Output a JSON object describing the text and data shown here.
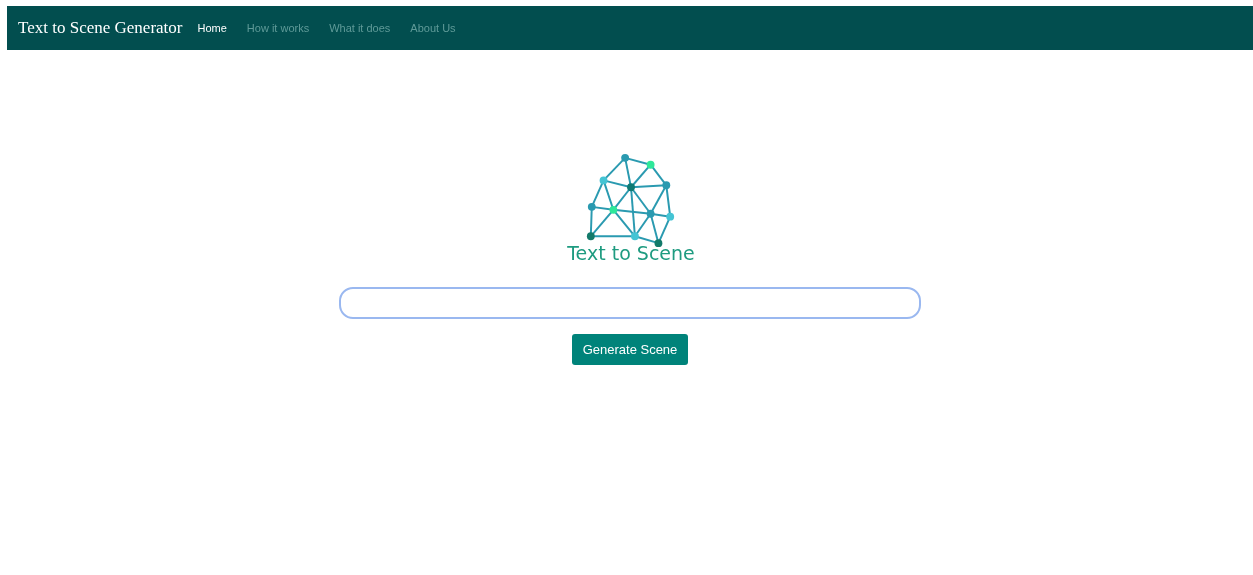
{
  "navbar": {
    "brand": "Text to Scene Generator",
    "links": [
      {
        "label": "Home",
        "selected": true
      },
      {
        "label": "How it works",
        "selected": false
      },
      {
        "label": "What it does",
        "selected": false
      },
      {
        "label": "About Us",
        "selected": false
      }
    ]
  },
  "logo": {
    "caption": "Text to Scene"
  },
  "button": {
    "label": "Generate Scene"
  }
}
